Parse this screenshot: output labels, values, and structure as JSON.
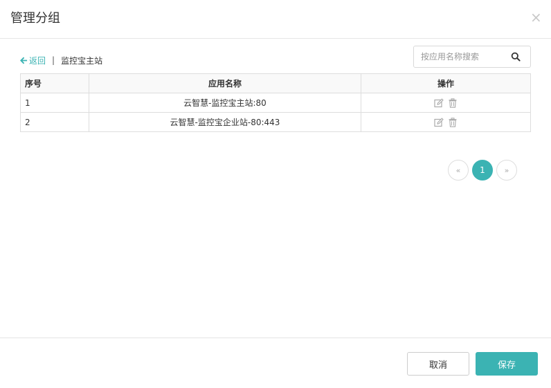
{
  "dialog": {
    "title": "管理分组",
    "close_label": "×"
  },
  "nav": {
    "back_label": "返回",
    "separator": "|",
    "current": "监控宝主站"
  },
  "search": {
    "placeholder": "按应用名称搜索",
    "value": ""
  },
  "table": {
    "headers": [
      "序号",
      "应用名称",
      "操作"
    ],
    "rows": [
      {
        "index": "1",
        "name": "云智慧-监控宝主站:80"
      },
      {
        "index": "2",
        "name": "云智慧-监控宝企业站-80:443"
      }
    ]
  },
  "pagination": {
    "prev": "«",
    "current_page": "1",
    "next": "»"
  },
  "footer": {
    "cancel_label": "取消",
    "save_label": "保存"
  },
  "colors": {
    "accent": "#3bb3b3",
    "border": "#dddddd",
    "icon_gray": "#aaaaaa"
  },
  "icons": {
    "back": "arrow-left-icon",
    "search": "search-icon",
    "edit": "edit-icon",
    "delete": "trash-icon"
  }
}
